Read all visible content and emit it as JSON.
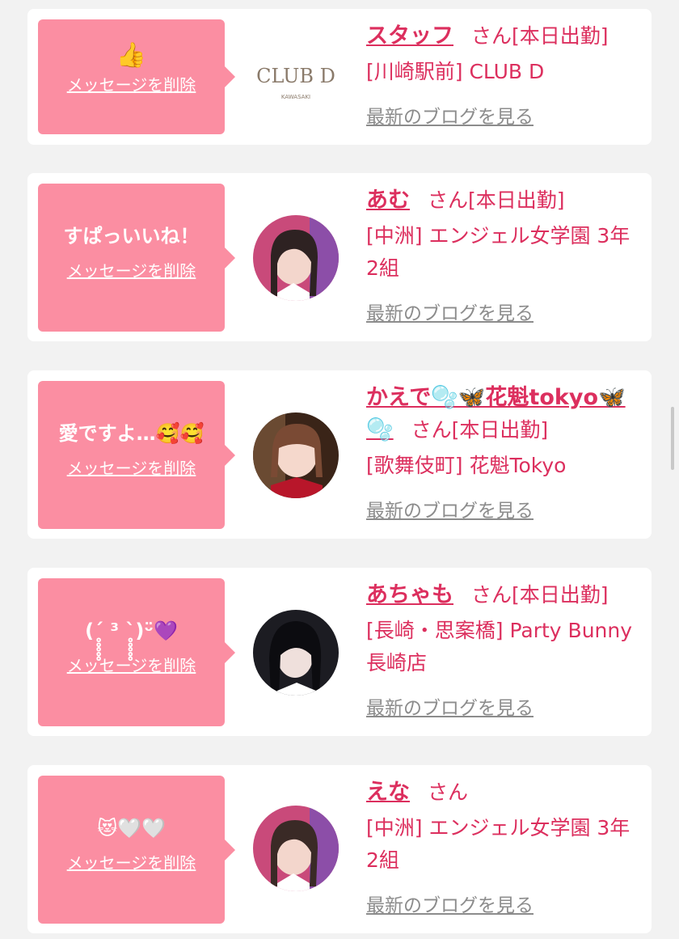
{
  "ui": {
    "delete_label": "メッセージを削除",
    "blog_label": "最新のブログを見る",
    "honorific": "さん"
  },
  "cards": [
    {
      "message": "",
      "message_icon": "thumbs-up-icon",
      "name": "スタッフ",
      "status": "[本日出勤]",
      "shop": "[川崎駅前] CLUB D",
      "avatar": "club-d-logo",
      "logo_text": "CLUB D",
      "logo_sub": "KAWASAKI"
    },
    {
      "message": "すぱっいいね！",
      "name": "あむ",
      "status": "[本日出勤]",
      "shop": "[中洲] エンジェル女学園 3年2組",
      "avatar": "photo"
    },
    {
      "message": "愛ですよ…🥰🥰",
      "name": "かえで🫧🦋花魁tokyo🦋🫧",
      "status": "[本日出勤]",
      "shop": "[歌舞伎町] 花魁Tokyo",
      "avatar": "photo"
    },
    {
      "message": "(ˊ̥̥̥̥̥ ³ ˋ̥̥̥̥̥)ᵕ̈💜",
      "name": "あちゃも",
      "status": "[本日出勤]",
      "shop": "[長崎・思案橋] Party Bunny 長崎店",
      "avatar": "photo"
    },
    {
      "message": "😻🤍🤍",
      "name": "えな",
      "status": "",
      "shop": "[中洲] エンジェル女学園 3年2組",
      "avatar": "photo"
    }
  ],
  "colors": {
    "bubble": "#fb8ea2",
    "accent": "#dc2f5e",
    "link_gray": "#8c8c8c",
    "background": "#f2f2f2"
  }
}
